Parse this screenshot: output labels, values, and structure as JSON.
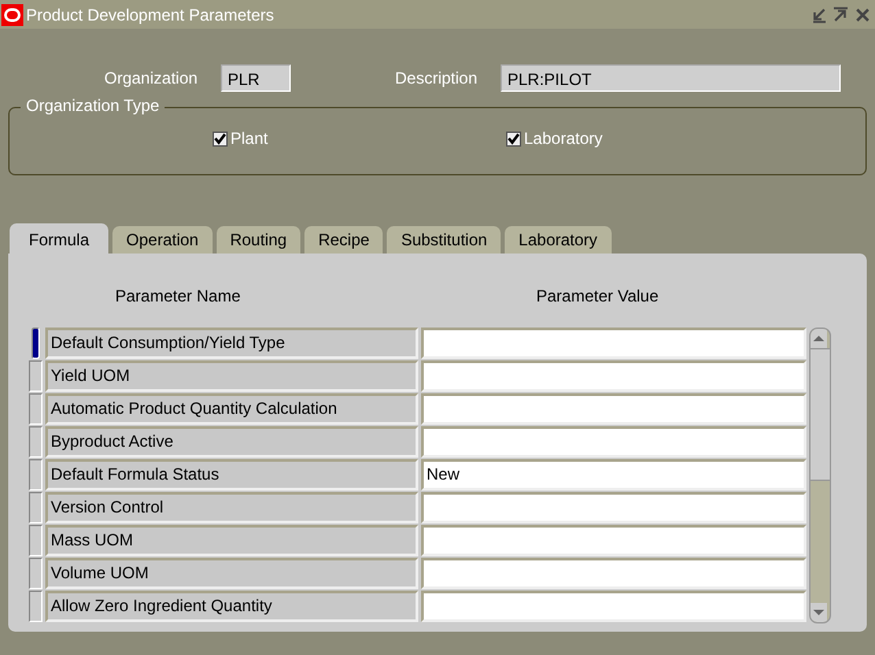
{
  "window": {
    "title": "Product Development Parameters"
  },
  "organization": {
    "label": "Organization",
    "value": "PLR"
  },
  "description": {
    "label": "Description",
    "value": "PLR:PILOT"
  },
  "organization_type": {
    "label": "Organization Type",
    "options": [
      {
        "label": "Plant",
        "checked": true
      },
      {
        "label": "Laboratory",
        "checked": true
      }
    ]
  },
  "tabs": [
    {
      "label": "Formula",
      "selected": true
    },
    {
      "label": "Operation",
      "selected": false
    },
    {
      "label": "Routing",
      "selected": false
    },
    {
      "label": "Recipe",
      "selected": false
    },
    {
      "label": "Substitution",
      "selected": false
    },
    {
      "label": "Laboratory",
      "selected": false
    }
  ],
  "table": {
    "columns": [
      "Parameter Name",
      "Parameter Value"
    ],
    "rows": [
      {
        "name": "Default Consumption/Yield Type",
        "value": "",
        "selected": true
      },
      {
        "name": "Yield UOM",
        "value": "",
        "selected": false
      },
      {
        "name": "Automatic Product Quantity Calculation",
        "value": "",
        "selected": false
      },
      {
        "name": "Byproduct Active",
        "value": "",
        "selected": false
      },
      {
        "name": "Default Formula Status",
        "value": "New",
        "selected": false
      },
      {
        "name": "Version Control",
        "value": "",
        "selected": false
      },
      {
        "name": "Mass UOM",
        "value": "",
        "selected": false
      },
      {
        "name": "Volume UOM",
        "value": "",
        "selected": false
      },
      {
        "name": "Allow Zero Ingredient Quantity",
        "value": "",
        "selected": false
      }
    ]
  }
}
